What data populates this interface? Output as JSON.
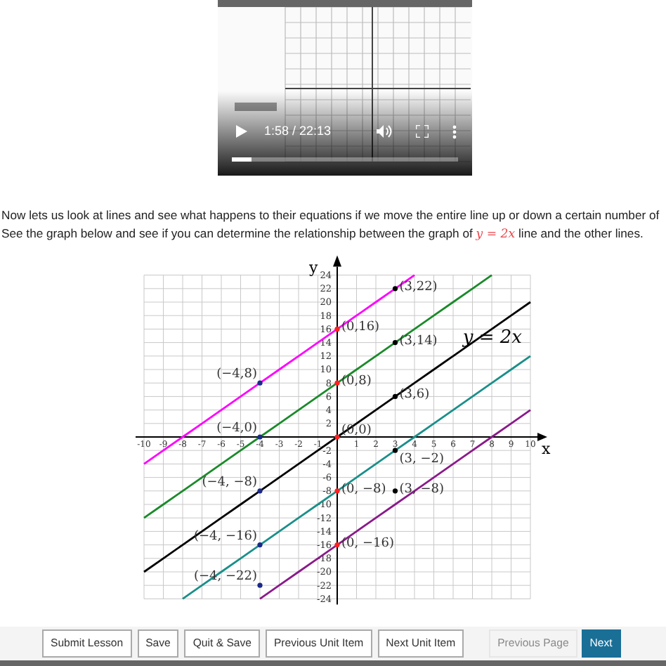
{
  "video": {
    "time": "1:58 / 22:13",
    "progress": {
      "level": 0.09
    }
  },
  "intro": {
    "line_1": "Now lets us look at lines and see what happens to their equations if we move the entire line up or down a certain number of",
    "line_2_before": "See the graph below and see if you can determine the relationship between the graph of ",
    "line_2_math": "y = 2x",
    "line_2_after": " line and the other lines."
  },
  "graph": {
    "chart_data": {
      "type": "line",
      "xlabel": "x",
      "ylabel": "y",
      "grid": true,
      "x": [
        -10,
        -9,
        -8,
        -7,
        -6,
        -5,
        -4,
        -3,
        -2,
        -1,
        0,
        1,
        2,
        3,
        4,
        5,
        6,
        7,
        8,
        9,
        10
      ],
      "series": [
        {
          "color": "#ff00ff",
          "values": [
            -4,
            -2,
            0,
            2,
            4,
            6,
            8,
            10,
            12,
            14,
            16,
            18,
            20,
            22,
            24,
            null,
            null,
            null,
            null,
            null,
            null
          ]
        },
        {
          "color": "#1a8a2a",
          "values": [
            -12,
            -10,
            -8,
            -6,
            -4,
            -2,
            0,
            2,
            4,
            6,
            8,
            10,
            12,
            14,
            16,
            18,
            20,
            22,
            24,
            null,
            null
          ]
        },
        {
          "color": "#000000",
          "values": [
            -20,
            -18,
            -16,
            -14,
            -12,
            -10,
            -8,
            -6,
            -4,
            -2,
            0,
            2,
            4,
            6,
            8,
            10,
            12,
            14,
            16,
            18,
            20
          ]
        },
        {
          "color": "#1a8f8a",
          "values": [
            null,
            null,
            -24,
            -22,
            -20,
            -18,
            -16,
            -14,
            -12,
            -10,
            -8,
            -6,
            -4,
            -2,
            0,
            2,
            4,
            6,
            8,
            10,
            12
          ]
        },
        {
          "color": "#8a1a8a",
          "values": [
            null,
            null,
            null,
            null,
            null,
            null,
            -24,
            -22,
            -20,
            -18,
            -16,
            -14,
            -12,
            -10,
            -8,
            -6,
            -4,
            -2,
            0,
            2,
            4
          ]
        }
      ],
      "xlim": [
        -10,
        10
      ],
      "ylim": [
        -24,
        24
      ],
      "xticks": [
        -10,
        -9,
        -8,
        -7,
        -6,
        -5,
        -4,
        -3,
        -2,
        -1,
        1,
        2,
        3,
        4,
        5,
        6,
        7,
        8,
        9,
        10
      ],
      "yticks": [
        -24,
        -22,
        -20,
        -18,
        -16,
        -14,
        -12,
        -10,
        -8,
        -6,
        -4,
        -2,
        2,
        4,
        6,
        8,
        10,
        12,
        14,
        16,
        18,
        20,
        22,
        24
      ],
      "annotations": [
        {
          "x": 3,
          "y": 22,
          "text": "(3,22)"
        },
        {
          "x": 0,
          "y": 16,
          "text": "(0,16)"
        },
        {
          "x": -4,
          "y": 8,
          "text": "(−4,8)"
        },
        {
          "x": 3,
          "y": 14,
          "text": "(3,14)"
        },
        {
          "x": 0,
          "y": 8,
          "text": "(0,8)"
        },
        {
          "x": -4,
          "y": 0,
          "text": "(−4,0)"
        },
        {
          "x": 3,
          "y": 6,
          "text": "(3,6)"
        },
        {
          "x": 0,
          "y": 0,
          "text": "(0,0)"
        },
        {
          "x": -4,
          "y": -8,
          "text": "(−4, −8)"
        },
        {
          "x": 3,
          "y": -2,
          "text": "(3, −2)"
        },
        {
          "x": 0,
          "y": -8,
          "text": "(0, −8)"
        },
        {
          "x": -4,
          "y": -16,
          "text": "(−4, −16)"
        },
        {
          "x": 3,
          "y": -8,
          "text": "(3, −8)"
        },
        {
          "x": 0,
          "y": -16,
          "text": "(0, −16)"
        },
        {
          "x": -4,
          "y": -22,
          "text": "(−4, −22)"
        },
        {
          "x": 6.5,
          "y": 14,
          "text": "y = 2x"
        }
      ]
    },
    "point_dots": [
      {
        "color": "#000000"
      },
      {
        "color": "#ff2020"
      },
      {
        "color": "#1a2a8a"
      },
      {
        "color": "#000000"
      },
      {
        "color": "#ff2020"
      },
      {
        "color": "#1a2a8a"
      },
      {
        "color": "#000000"
      },
      {
        "color": "#ff2020"
      },
      {
        "color": "#1a2a8a"
      },
      {
        "color": "#000000"
      },
      {
        "color": "#ff2020"
      },
      {
        "color": "#1a2a8a"
      },
      {
        "color": "#000000"
      },
      {
        "color": "#ff2020"
      },
      {
        "color": "#1a2a8a"
      }
    ]
  },
  "footer": {
    "buttons": [
      {
        "label": "Submit Lesson",
        "kind": "plain",
        "disabled": false
      },
      {
        "label": "Save",
        "kind": "plain",
        "disabled": false
      },
      {
        "label": "Quit & Save",
        "kind": "plain",
        "disabled": false
      },
      {
        "label": "Previous Unit Item",
        "kind": "plain",
        "disabled": false
      },
      {
        "label": "Next Unit Item",
        "kind": "plain",
        "disabled": false
      },
      {
        "label": "Previous Page",
        "kind": "plain",
        "disabled": true
      },
      {
        "label": "Next",
        "kind": "primary",
        "disabled": false
      }
    ]
  }
}
